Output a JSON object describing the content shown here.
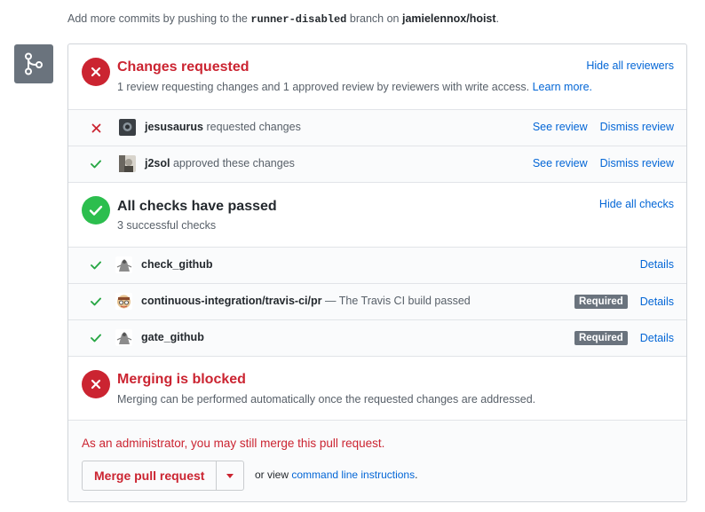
{
  "top_note": {
    "prefix": "Add more commits by pushing to the",
    "branch": "runner-disabled",
    "mid": "branch on",
    "repo": "jamielennox/hoist",
    "suffix": "."
  },
  "reviews": {
    "title": "Changes requested",
    "subtitle": "1 review requesting changes and 1 approved review by reviewers with write access.",
    "learn_more": "Learn more.",
    "hide_label": "Hide all reviewers",
    "items": [
      {
        "user": "jesusaurus",
        "action": "requested changes",
        "status": "x-icon",
        "see": "See review",
        "dismiss": "Dismiss review"
      },
      {
        "user": "j2sol",
        "action": "approved these changes",
        "status": "check-icon",
        "see": "See review",
        "dismiss": "Dismiss review"
      }
    ]
  },
  "checks": {
    "title": "All checks have passed",
    "subtitle": "3 successful checks",
    "hide_label": "Hide all checks",
    "items": [
      {
        "name": "check_github",
        "desc": "",
        "required": "",
        "details": "Details"
      },
      {
        "name": "continuous-integration/travis-ci/pr",
        "desc": "— The Travis CI build passed",
        "required": "Required",
        "details": "Details"
      },
      {
        "name": "gate_github",
        "desc": "",
        "required": "Required",
        "details": "Details"
      }
    ]
  },
  "merge": {
    "title": "Merging is blocked",
    "subtitle": "Merging can be performed automatically once the requested changes are addressed.",
    "admin_note": "As an administrator, you may still merge this pull request.",
    "button_label": "Merge pull request",
    "or_view": "or view",
    "cli_link": "command line instructions",
    "cli_suffix": "."
  },
  "colors": {
    "danger": "#cb2431",
    "success": "#2cbe4e",
    "link": "#0366d6"
  }
}
